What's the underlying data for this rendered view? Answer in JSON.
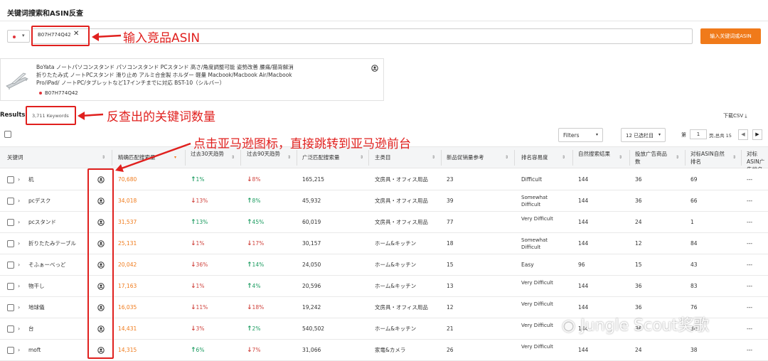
{
  "page_title": "关键词搜索和ASIN反查",
  "search": {
    "asin_chip": "B07H774Q42",
    "chip_close_glyph": "✕",
    "market_caret": "▾",
    "button_label": "输入关键词或ASIN"
  },
  "product": {
    "title": "BoYata ノートパソコンスタンド パソコンスタンド PCスタンド 高さ/角度調整可能 姿勢改善 腰痛/猫背解消 折りたたみ式 ノートPCスタンド 滑り止め アルミ合金製 ホルダー 軽量 Macbook/Macbook Air/Macbook Pro/iPad/ ノートPC/タブレットなど17インチまでに対応 BST-10（シルバー）",
    "asin": "B07H774Q42"
  },
  "results": {
    "label": "Results",
    "count": "3,711 Keywords",
    "download": "下载CSV ⤓"
  },
  "toolbar": {
    "filters": "Filters",
    "columns": "12 已选栏目",
    "caret": "▾",
    "page_label": "第",
    "page_value": "1",
    "page_total": "页,总共 15",
    "prev": "◀",
    "next": "▶"
  },
  "columns": [
    "关键词",
    "精确匹配搜索量",
    "过去30天趋势",
    "过去90天趋势",
    "广泛匹配搜索量",
    "主类目",
    "新品促销量参考",
    "排名容易度",
    "自然搜索结果",
    "投放广告商品数",
    "对标ASIN自然排名",
    "对标ASIN广告排名"
  ],
  "rows": [
    {
      "keyword": "机",
      "volume": "70,680",
      "t30_dir": "up",
      "t30": "1%",
      "t90_dir": "down",
      "t90": "8%",
      "broad": "165,215",
      "category": "文房具・オフィス用品",
      "promo": "23",
      "ease": "Difficult",
      "organic": "144",
      "ads": "36",
      "asin_rank": "69",
      "asin_ad": "---"
    },
    {
      "keyword": "pcデスク",
      "volume": "34,018",
      "t30_dir": "down",
      "t30": "13%",
      "t90_dir": "up",
      "t90": "8%",
      "broad": "45,932",
      "category": "文房具・オフィス用品",
      "promo": "39",
      "ease": "Somewhat Difficult",
      "organic": "144",
      "ads": "36",
      "asin_rank": "66",
      "asin_ad": "---"
    },
    {
      "keyword": "pcスタンド",
      "volume": "31,537",
      "t30_dir": "up",
      "t30": "13%",
      "t90_dir": "up",
      "t90": "45%",
      "broad": "60,019",
      "category": "文房具・オフィス用品",
      "promo": "77",
      "ease": "Very Difficult",
      "organic": "144",
      "ads": "24",
      "asin_rank": "1",
      "asin_ad": "---"
    },
    {
      "keyword": "折りたたみテーブル",
      "volume": "25,131",
      "t30_dir": "down",
      "t30": "1%",
      "t90_dir": "down",
      "t90": "17%",
      "broad": "30,157",
      "category": "ホーム&キッチン",
      "promo": "18",
      "ease": "Somewhat Difficult",
      "organic": "144",
      "ads": "12",
      "asin_rank": "84",
      "asin_ad": "---"
    },
    {
      "keyword": "そふぁーべっど",
      "volume": "20,042",
      "t30_dir": "down",
      "t30": "36%",
      "t90_dir": "up",
      "t90": "14%",
      "broad": "24,050",
      "category": "ホーム&キッチン",
      "promo": "15",
      "ease": "Easy",
      "organic": "96",
      "ads": "15",
      "asin_rank": "43",
      "asin_ad": "---"
    },
    {
      "keyword": "物干し",
      "volume": "17,163",
      "t30_dir": "down",
      "t30": "1%",
      "t90_dir": "up",
      "t90": "4%",
      "broad": "20,596",
      "category": "ホーム&キッチン",
      "promo": "13",
      "ease": "Very Difficult",
      "organic": "144",
      "ads": "36",
      "asin_rank": "83",
      "asin_ad": "---"
    },
    {
      "keyword": "地球儀",
      "volume": "16,035",
      "t30_dir": "down",
      "t30": "11%",
      "t90_dir": "down",
      "t90": "18%",
      "broad": "19,242",
      "category": "文房具・オフィス用品",
      "promo": "12",
      "ease": "Very Difficult",
      "organic": "144",
      "ads": "36",
      "asin_rank": "76",
      "asin_ad": "---"
    },
    {
      "keyword": "台",
      "volume": "14,431",
      "t30_dir": "down",
      "t30": "3%",
      "t90_dir": "up",
      "t90": "2%",
      "broad": "540,502",
      "category": "ホーム&キッチン",
      "promo": "21",
      "ease": "Very Difficult",
      "organic": "144",
      "ads": "36",
      "asin_rank": "34",
      "asin_ad": "---"
    },
    {
      "keyword": "moft",
      "volume": "14,315",
      "t30_dir": "up",
      "t30": "6%",
      "t90_dir": "down",
      "t90": "7%",
      "broad": "31,066",
      "category": "家電&カメラ",
      "promo": "26",
      "ease": "Very Difficult",
      "organic": "144",
      "ads": "24",
      "asin_rank": "38",
      "asin_ad": "---"
    }
  ],
  "annotations": {
    "asin": "输入竞品ASIN",
    "keywords": "反查出的关键词数量",
    "amazon": "点击亚马逊图标，直接跳转到亚马逊前台"
  },
  "watermark": "Jungle Scout奖歌",
  "colors": {
    "accent_orange": "#f07a1a",
    "annotation_red": "#e0201e",
    "trend_up": "#1a9b5f",
    "trend_down": "#d0443e"
  }
}
